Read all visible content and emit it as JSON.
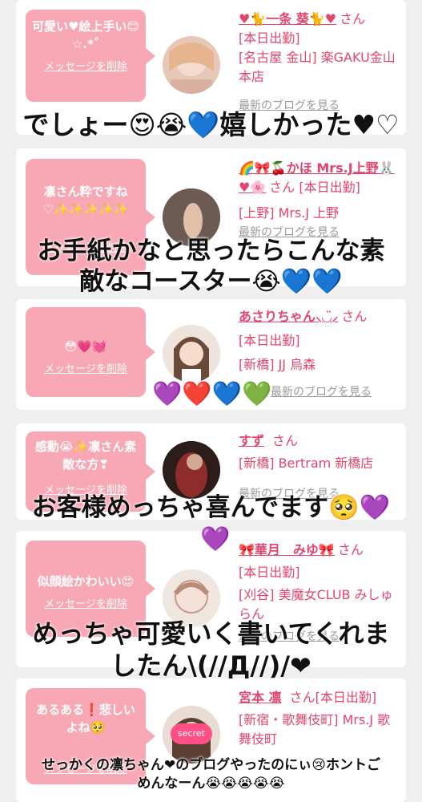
{
  "cards": [
    {
      "message": "可愛い♥絵上手い😊☆.*˚",
      "delete_label": "メッセージを削除",
      "name": "♥🐈一条 葵🐈♥",
      "san": "さん",
      "status": "[本日出勤]",
      "shop": "[名古屋 金山] 楽GAKU金山本店",
      "blog_link": "最新のブログを見る"
    },
    {
      "message": "凛さん粋ですね♡✨✨✨✨✨",
      "delete_label": "メッセージを削除",
      "name": "🌈🎀🍒かほ Mrs.J上野🐰♥🌸",
      "san": "さん",
      "status": "[本日出勤]",
      "shop": "[上野] Mrs.J 上野",
      "blog_link": "最新のブログを見る"
    },
    {
      "message": "😳💗💓",
      "delete_label": "メッセージを削除",
      "name": "あさりちゃん⸜◡̈⸝",
      "san": "さん",
      "status": "[本日出勤]",
      "shop": "[新橋] JJ 烏森",
      "blog_link": "最新のブログを見る"
    },
    {
      "message": "感動😭✨凛さん素敵な方❣",
      "delete_label": "メッセージを削除",
      "name": "すず",
      "san": "さん",
      "status": "",
      "shop": "[新橋] Bertram 新橋店",
      "blog_link": "最新のブログを見る"
    },
    {
      "message": "似顔絵かわいい😍",
      "delete_label": "メッセージを削除",
      "name": "🎀華月　みゆ🎀",
      "san": "さん",
      "status": "[本日出勤]",
      "shop": "[刈谷] 美魔女CLUB みしゅらん",
      "blog_link": "最新のブログを見る"
    },
    {
      "message": "あるある❗悲しいよね🥺",
      "delete_label": "メッセージを削除",
      "name": "宮本 凛",
      "san": "さん",
      "status": "[本日出勤]",
      "shop": "[新宿・歌舞伎町] Mrs.J 歌舞伎町",
      "blog_link": ""
    }
  ],
  "captions": {
    "c1": "でしょー😍😭💙嬉しかった♥♡",
    "c2a": "お手紙かなと思ったらこんな素",
    "c2b": "敵なコースター😭💙💙",
    "c3": "💜❤️💙💚",
    "c4": "お客様めっちゃ喜んでます🥺💜",
    "c4b": "💜",
    "c5a": "めっちゃ可愛いく書いてくれま",
    "c5b": "したん\\(//Д//)/❤",
    "c6a": "せっかくの凛ちゃん❤のブログやったのにぃ😢ホントご",
    "c6b": "めんなーん😭😭😭😭😭"
  },
  "avatar_badge": "secret",
  "colors": {
    "bubble": "#f7a8b4",
    "accent": "#e2456d",
    "muted": "#9a9a9a"
  }
}
